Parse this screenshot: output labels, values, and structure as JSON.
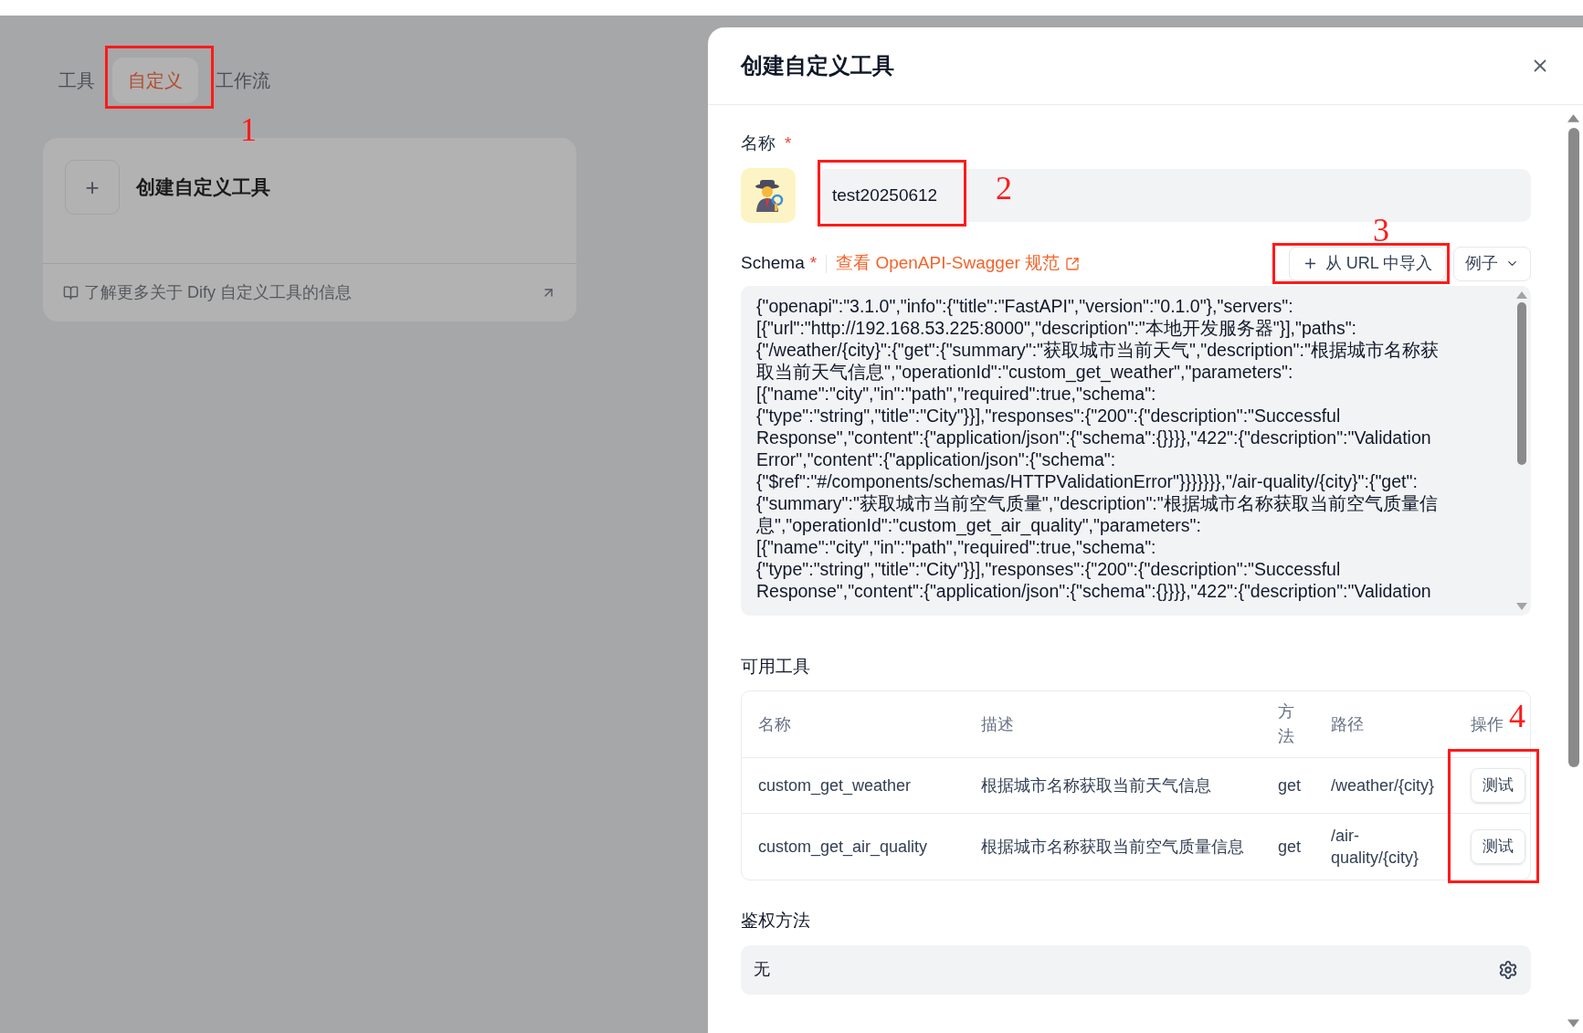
{
  "nav_tabs": [
    {
      "label": "工具",
      "selected": false
    },
    {
      "label": "自定义",
      "selected": true
    },
    {
      "label": "工作流",
      "selected": false
    }
  ],
  "create_card": {
    "plus": "+",
    "title": "创建自定义工具",
    "learn_more": "了解更多关于 Dify 自定义工具的信息"
  },
  "drawer": {
    "title": "创建自定义工具",
    "name_field": {
      "label": "名称",
      "required": "*",
      "value": "test20250612"
    },
    "schema": {
      "label": "Schema",
      "required": "*",
      "spec_link": "查看 OpenAPI-Swagger 规范",
      "import_button": "从 URL 中导入",
      "example_button": "例子",
      "lines": [
        "{\"openapi\":\"3.1.0\",\"info\":{\"title\":\"FastAPI\",\"version\":\"0.1.0\"},\"servers\":",
        "[{\"url\":\"http://192.168.53.225:8000\",\"description\":\"本地开发服务器\"}],\"paths\":",
        "{\"/weather/{city}\":{\"get\":{\"summary\":\"获取城市当前天气\",\"description\":\"根据城市名称获",
        "取当前天气信息\",\"operationId\":\"custom_get_weather\",\"parameters\":",
        "[{\"name\":\"city\",\"in\":\"path\",\"required\":true,\"schema\":",
        "{\"type\":\"string\",\"title\":\"City\"}}],\"responses\":{\"200\":{\"description\":\"Successful",
        "Response\",\"content\":{\"application/json\":{\"schema\":{}}}},\"422\":{\"description\":\"Validation",
        "Error\",\"content\":{\"application/json\":{\"schema\":",
        "{\"$ref\":\"#/components/schemas/HTTPValidationError\"}}}}}}},\"/air-quality/{city}\":{\"get\":",
        "{\"summary\":\"获取城市当前空气质量\",\"description\":\"根据城市名称获取当前空气质量信",
        "息\",\"operationId\":\"custom_get_air_quality\",\"parameters\":",
        "[{\"name\":\"city\",\"in\":\"path\",\"required\":true,\"schema\":",
        "{\"type\":\"string\",\"title\":\"City\"}}],\"responses\":{\"200\":{\"description\":\"Successful",
        "Response\",\"content\":{\"application/json\":{\"schema\":{}}}},\"422\":{\"description\":\"Validation"
      ]
    },
    "tools": {
      "label": "可用工具",
      "columns": [
        "名称",
        "描述",
        "方法",
        "路径",
        "操作"
      ],
      "rows": [
        {
          "name": "custom_get_weather",
          "description": "根据城市名称获取当前天气信息",
          "method": "get",
          "path": "/weather/{city}",
          "action": "测试"
        },
        {
          "name": "custom_get_air_quality",
          "description": "根据城市名称获取当前空气质量信息",
          "method": "get",
          "path": "/air-quality/{city}",
          "action": "测试"
        }
      ]
    },
    "auth": {
      "label": "鉴权方法",
      "value": "无"
    }
  },
  "annotations": [
    {
      "label": "1"
    },
    {
      "label": "2"
    },
    {
      "label": "3"
    },
    {
      "label": "4"
    }
  ]
}
